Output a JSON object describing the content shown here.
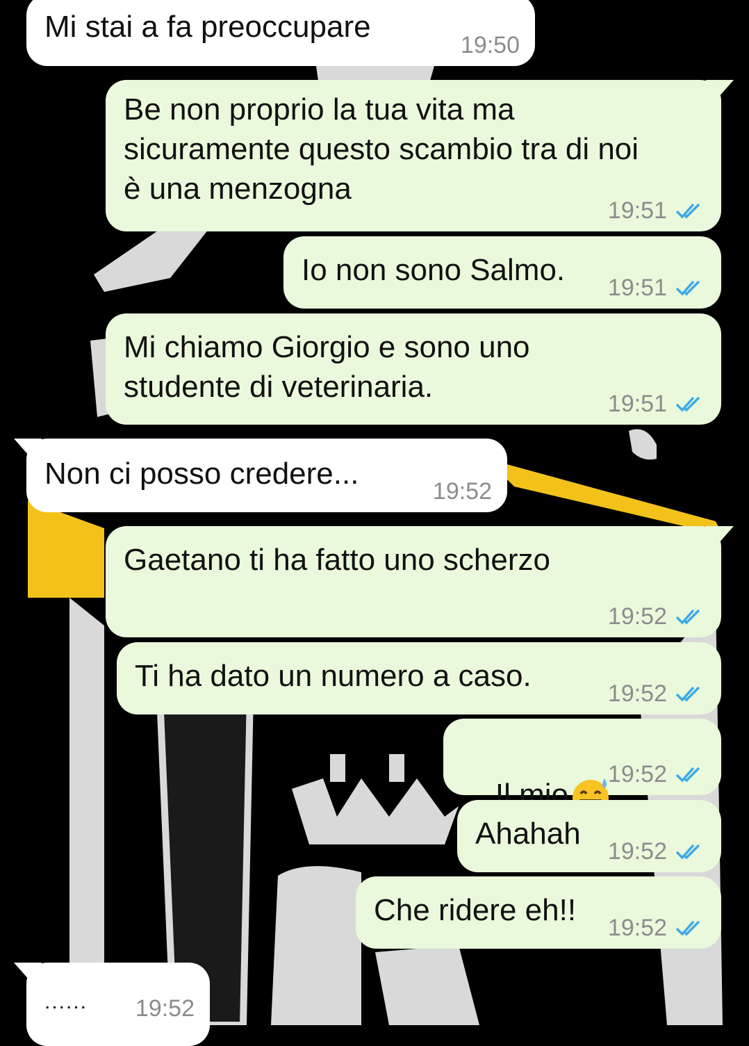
{
  "colors": {
    "incoming_bubble": "#ffffff",
    "outgoing_bubble": "#eaf9dc",
    "timestamp": "#8c8c8c",
    "read_ticks": "#3fa9e6",
    "wallpaper_bg": "#000000",
    "wallpaper_logo": "#d9d9d9",
    "wallpaper_accent": "#f2c21b"
  },
  "wallpaper": {
    "description_icon": "football-club-crest-wallpaper"
  },
  "messages": [
    {
      "direction": "in",
      "text": "Mi stai a fa preoccupare",
      "time": "19:50"
    },
    {
      "direction": "out",
      "text": "Be non proprio la tua vita ma\nsicuramente questo scambio tra di noi\nè una menzogna",
      "time": "19:51",
      "status": "read"
    },
    {
      "direction": "out",
      "text": "Io non sono Salmo.",
      "time": "19:51",
      "status": "read"
    },
    {
      "direction": "out",
      "text": "Mi chiamo Giorgio e sono uno\nstudente di veterinaria.",
      "time": "19:51",
      "status": "read"
    },
    {
      "direction": "in",
      "text": "Non ci posso credere...",
      "time": "19:52"
    },
    {
      "direction": "out",
      "text": "Gaetano ti ha fatto uno scherzo",
      "time": "19:52",
      "status": "read"
    },
    {
      "direction": "out",
      "text": "Ti ha dato un numero a caso.",
      "time": "19:52",
      "status": "read"
    },
    {
      "direction": "out",
      "text": "Il mio",
      "emoji": "grinning-face-with-sweat",
      "time": "19:52",
      "status": "read"
    },
    {
      "direction": "out",
      "text": "Ahahah",
      "time": "19:52",
      "status": "read"
    },
    {
      "direction": "out",
      "text": "Che ridere eh!!",
      "time": "19:52",
      "status": "read"
    },
    {
      "direction": "in",
      "text": "......",
      "time": "19:52"
    }
  ]
}
